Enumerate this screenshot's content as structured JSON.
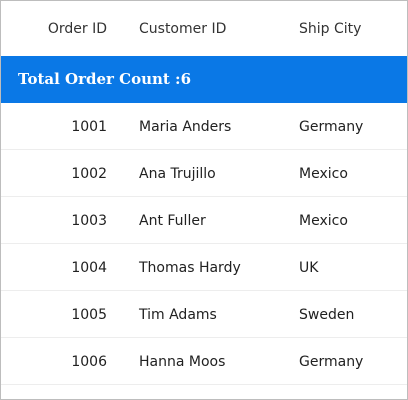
{
  "columns": {
    "order_id": "Order ID",
    "customer_id": "Customer ID",
    "ship_city": "Ship City"
  },
  "summary": {
    "label": "Total Order Count :6"
  },
  "rows": [
    {
      "order_id": "1001",
      "customer": "Maria Anders",
      "city": "Germany"
    },
    {
      "order_id": "1002",
      "customer": "Ana Trujillo",
      "city": "Mexico"
    },
    {
      "order_id": "1003",
      "customer": "Ant Fuller",
      "city": "Mexico"
    },
    {
      "order_id": "1004",
      "customer": "Thomas Hardy",
      "city": "UK"
    },
    {
      "order_id": "1005",
      "customer": "Tim Adams",
      "city": "Sweden"
    },
    {
      "order_id": "1006",
      "customer": "Hanna Moos",
      "city": "Germany"
    }
  ],
  "colors": {
    "summary_background": "#0a78e6",
    "row_divider": "#ededed",
    "grid_border": "#bdbdbd"
  }
}
